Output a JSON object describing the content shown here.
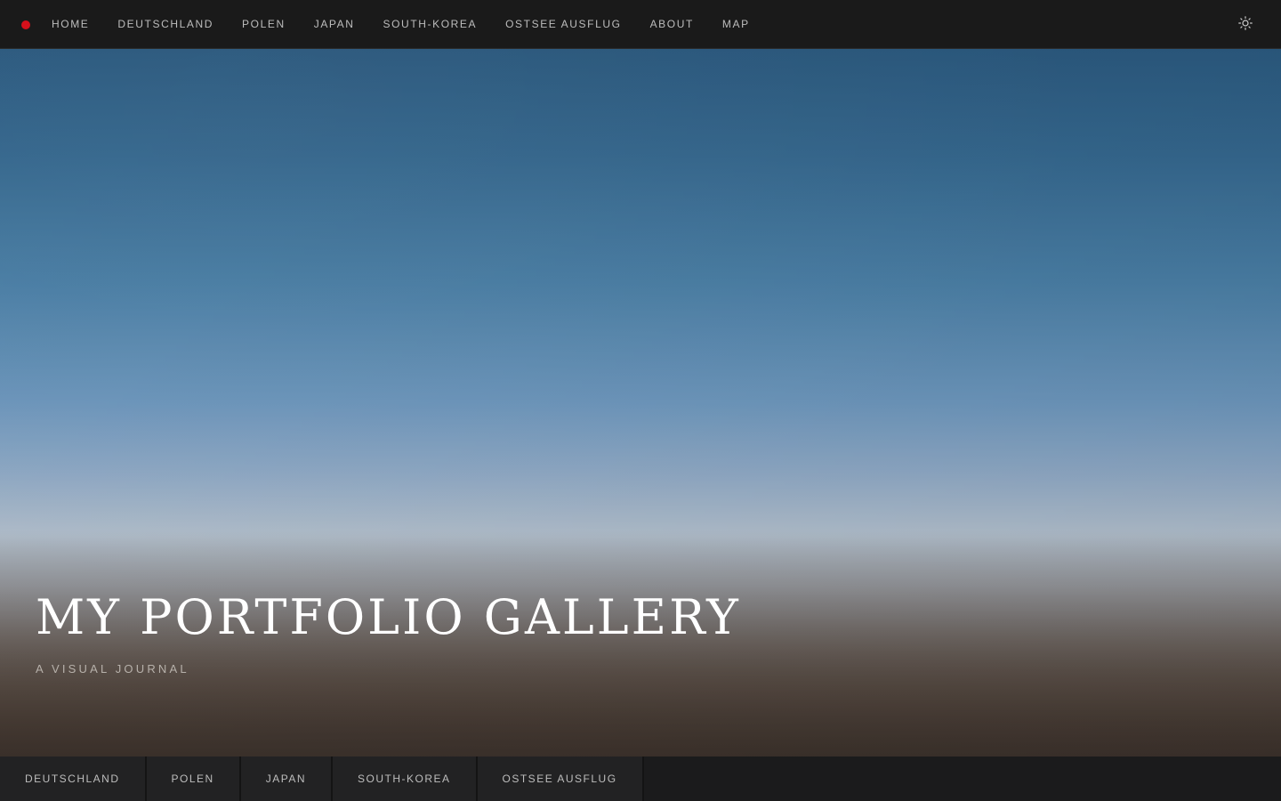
{
  "nav": {
    "items": [
      {
        "label": "HOME"
      },
      {
        "label": "DEUTSCHLAND"
      },
      {
        "label": "POLEN"
      },
      {
        "label": "JAPAN"
      },
      {
        "label": "SOUTH-KOREA"
      },
      {
        "label": "OSTSEE AUSFLUG"
      },
      {
        "label": "ABOUT"
      },
      {
        "label": "MAP"
      }
    ],
    "brand_icon": "red-dot-icon",
    "theme_icon": "sun-icon"
  },
  "hero": {
    "title": "MY PORTFOLIO GALLERY",
    "subtitle": "A VISUAL JOURNAL"
  },
  "bottom_tabs": [
    {
      "label": "DEUTSCHLAND"
    },
    {
      "label": "POLEN"
    },
    {
      "label": "JAPAN"
    },
    {
      "label": "SOUTH-KOREA"
    },
    {
      "label": "OSTSEE AUSFLUG"
    }
  ],
  "colors": {
    "accent": "#d6101b",
    "bar_background": "#1a1a1a",
    "nav_text": "#bdbdbd"
  }
}
